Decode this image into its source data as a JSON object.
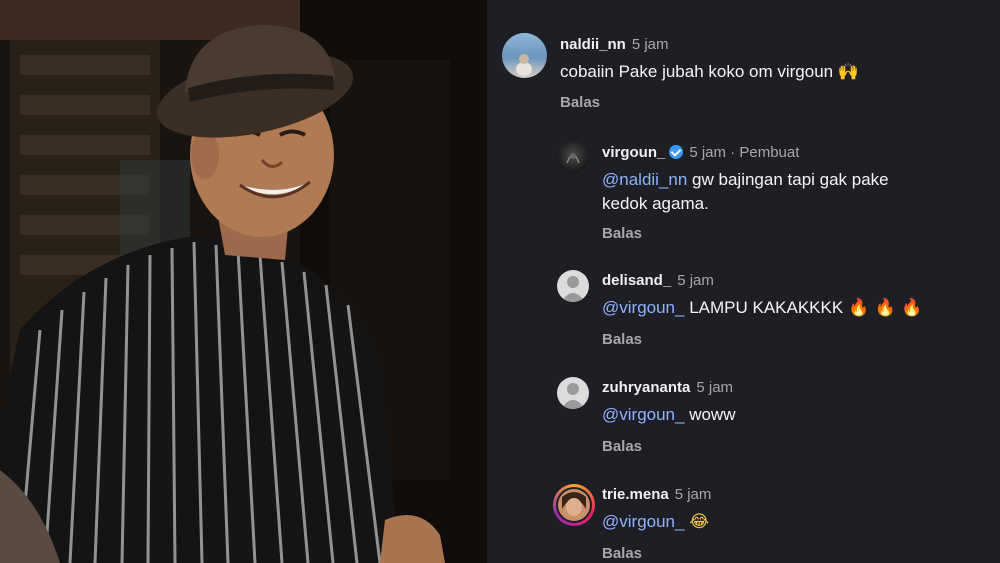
{
  "comments": [
    {
      "username": "naldii_nn",
      "time": "5 jam",
      "text": "cobaiin Pake jubah koko om virgoun",
      "emoji": "🙌",
      "reply_label": "Balas"
    },
    {
      "username": "virgoun_",
      "time": "5 jam",
      "meta": " · Pembuat",
      "mention": "@naldii_nn",
      "text_line1": " gw bajingan tapi gak pake",
      "text_line2": "kedok agama.",
      "reply_label": "Balas"
    },
    {
      "username": "delisand_",
      "time": "5 jam",
      "mention": "@virgoun_",
      "text": " LAMPU KAKAKKKK",
      "emoji": "🔥 🔥 🔥",
      "reply_label": "Balas"
    },
    {
      "username": "zuhryananta",
      "time": "5 jam",
      "mention": "@virgoun_",
      "text": " woww",
      "reply_label": "Balas"
    },
    {
      "username": "trie.mena",
      "time": "5 jam",
      "mention": "@virgoun_",
      "emoji": "😂",
      "reply_label": "Balas"
    }
  ],
  "colors": {
    "background": "#1e1f24",
    "mention": "#8fb2ff",
    "muted": "#a6a7ad",
    "verified": "#3897f0"
  }
}
